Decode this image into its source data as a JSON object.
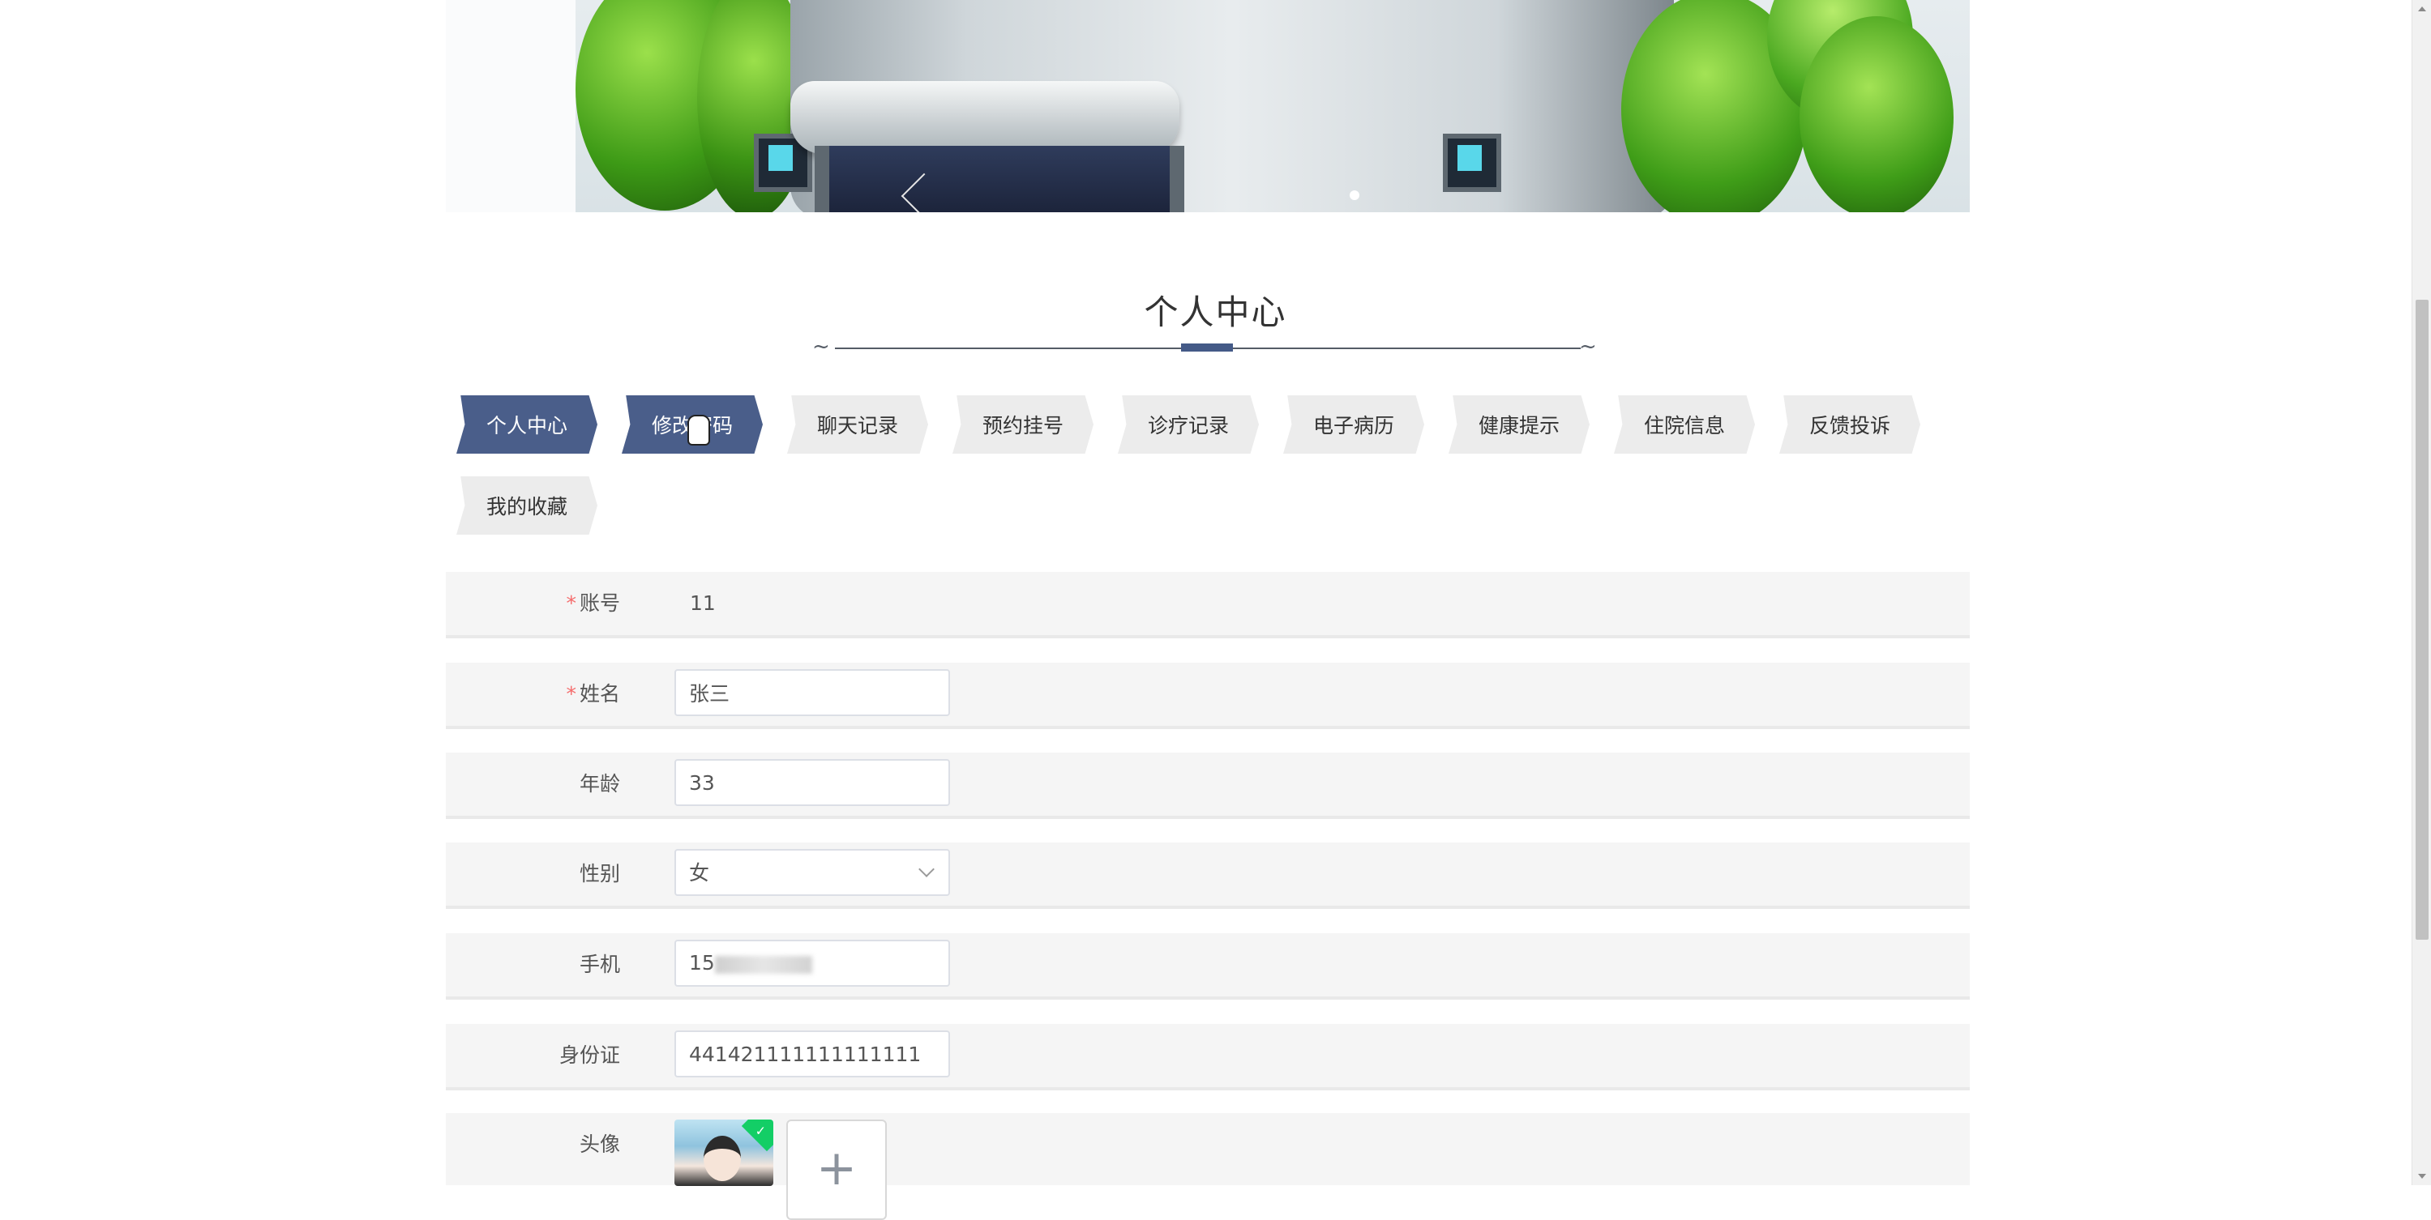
{
  "title": "个人中心",
  "tabs": [
    {
      "label": "个人中心",
      "active": true
    },
    {
      "label": "修改密码",
      "active": true
    },
    {
      "label": "聊天记录",
      "active": false
    },
    {
      "label": "预约挂号",
      "active": false
    },
    {
      "label": "诊疗记录",
      "active": false
    },
    {
      "label": "电子病历",
      "active": false
    },
    {
      "label": "健康提示",
      "active": false
    },
    {
      "label": "住院信息",
      "active": false
    },
    {
      "label": "反馈投诉",
      "active": false
    },
    {
      "label": "我的收藏",
      "active": false
    }
  ],
  "form": {
    "account": {
      "required_mark": "*",
      "label": "账号",
      "value": "11"
    },
    "name": {
      "required_mark": "*",
      "label": "姓名",
      "value": "张三"
    },
    "age": {
      "label": "年龄",
      "value": "33"
    },
    "gender": {
      "label": "性别",
      "value": "女"
    },
    "phone": {
      "label": "手机",
      "value": "15"
    },
    "id_card": {
      "label": "身份证",
      "value": "441421111111111111"
    },
    "avatar": {
      "label": "头像",
      "upload_icon": "plus-icon",
      "uploaded_badge_icon": "check-icon"
    }
  },
  "colors": {
    "active_tab": "#4a5e8a",
    "tab": "#ececec",
    "required": "#f56c6c",
    "row_background": "#f5f5f5",
    "title_accent": "#445a87"
  },
  "icons": {
    "carousel_prev": "chevron-left-icon",
    "carousel_dot": "carousel-indicator-dot",
    "gender_dropdown": "chevron-down-icon"
  }
}
